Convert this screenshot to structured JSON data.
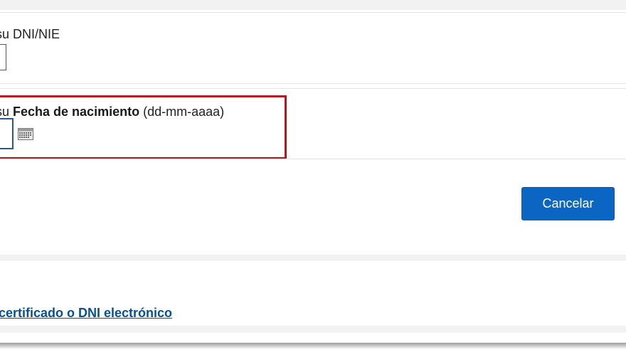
{
  "form": {
    "dni_field": {
      "label": "su DNI/NIE",
      "value": ""
    },
    "birthdate_field": {
      "label_prefix": "su ",
      "label_bold": "Fecha de nacimiento",
      "label_suffix": " (dd-mm-aaaa)",
      "value": "",
      "icon": "calendar-icon"
    },
    "highlight_color": "#b0191e"
  },
  "actions": {
    "cancel_label": "Cancelar",
    "accent_color": "#0a66c2"
  },
  "footer": {
    "link_text": "certificado o DNI electrónico"
  }
}
